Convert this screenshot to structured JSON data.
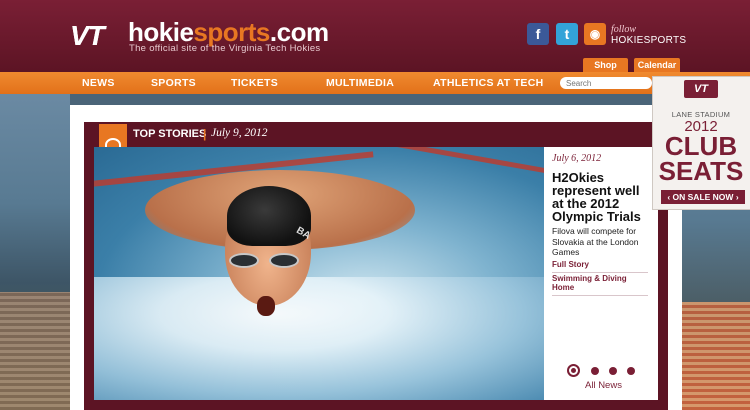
{
  "header": {
    "logo_mark": "VT",
    "site_name_a": "hokie",
    "site_name_b": "sports",
    "site_name_c": ".com",
    "tagline": "The official site of  the Virginia Tech Hokies",
    "follow_label": "follow",
    "follow_name": "HOKIESPORTS",
    "social_icons": [
      "facebook-icon",
      "twitter-icon",
      "rss-icon"
    ],
    "tabs": {
      "shop": "Shop",
      "calendar": "Calendar"
    }
  },
  "nav": {
    "items": [
      "NEWS",
      "SPORTS",
      "TICKETS",
      "MULTIMEDIA",
      "ATHLETICS AT TECH"
    ],
    "search_placeholder": "Search"
  },
  "top_stories": {
    "label": "TOP STORIES",
    "separator": "|",
    "date": "July 9, 2012",
    "story": {
      "date": "July 6, 2012",
      "title": "H2Okies represent well at the 2012 Olympic Trials",
      "summary": "Filova will compete for Slovakia at the London Games",
      "link_full": "Full Story",
      "link_home": "Swimming & Diving Home"
    },
    "photo_cap_text": "BA",
    "carousel": {
      "count": 4,
      "active": 1
    },
    "all_news": "All News"
  },
  "ad": {
    "logo": "VT",
    "venue": "LANE STADIUM",
    "year": "2012",
    "line1": "CLUB",
    "line2": "SEATS",
    "cta": "ON SALE NOW"
  },
  "colors": {
    "maroon": "#7a1f35",
    "orange": "#e87722"
  }
}
